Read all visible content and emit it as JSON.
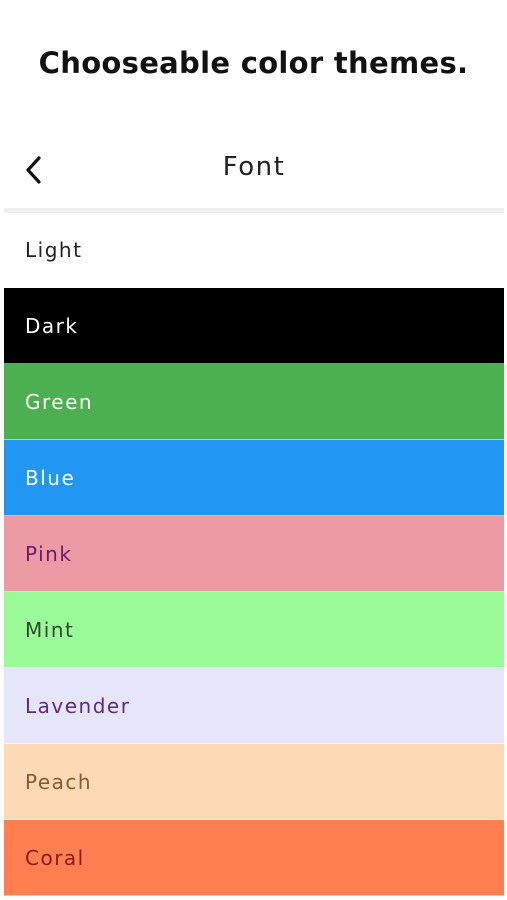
{
  "caption": "Chooseable color themes.",
  "nav": {
    "back_icon": "chevron-left-icon",
    "title": "Font"
  },
  "themes": [
    {
      "label": "Light",
      "bg": "#ffffff",
      "fg": "#222222"
    },
    {
      "label": "Dark",
      "bg": "#000000",
      "fg": "#ffffff"
    },
    {
      "label": "Green",
      "bg": "#4caf50",
      "fg": "#ffffff"
    },
    {
      "label": "Blue",
      "bg": "#2196f3",
      "fg": "#ffffff"
    },
    {
      "label": "Pink",
      "bg": "#ec9aa4",
      "fg": "#6a1b6a"
    },
    {
      "label": "Mint",
      "bg": "#98fb98",
      "fg": "#2e4a2e"
    },
    {
      "label": "Lavender",
      "bg": "#e6e6fa",
      "fg": "#5b2a86"
    },
    {
      "label": "Peach",
      "bg": "#fdd9b5",
      "fg": "#8b5a2b"
    },
    {
      "label": "Coral",
      "bg": "#ff7f50",
      "fg": "#8b1a1a"
    }
  ]
}
